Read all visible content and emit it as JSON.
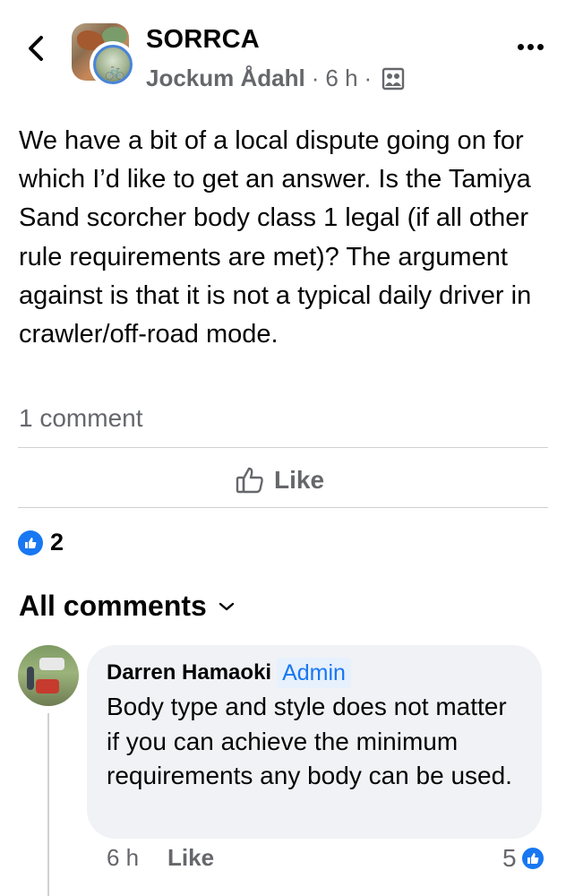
{
  "header": {
    "group_name": "SORRCA",
    "author": "Jockum Ådahl",
    "separator": "·",
    "time": "6 h",
    "audience_icon": "group-audience-icon"
  },
  "post": {
    "body": "We have a bit of a local dispute going on for which I’d like to get an answer. Is the Tamiya Sand scorcher body class 1 legal (if all other rule requirements are met)? The argument against is that it is not a typical daily driver in crawler/off-road mode.",
    "comment_count": "1 comment"
  },
  "actions": {
    "like_label": "Like"
  },
  "reactions": {
    "count": "2"
  },
  "comments_section": {
    "title": "All comments"
  },
  "comments": [
    {
      "name": "Darren Hamaoki",
      "badge": "Admin",
      "text": "Body type and style does not matter if you can achieve the minimum requirements any body can be used.",
      "time": "6 h",
      "like_label": "Like",
      "reaction_count": "5"
    }
  ],
  "colors": {
    "accent": "#1877f2",
    "secondary_text": "#65676b",
    "bubble": "#f0f2f5",
    "divider": "#ced0d4"
  }
}
